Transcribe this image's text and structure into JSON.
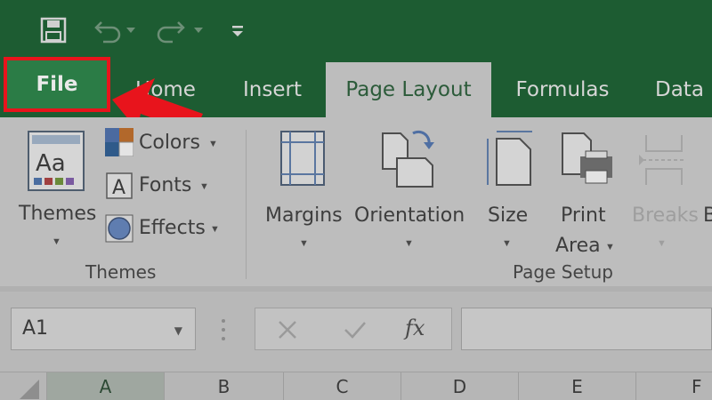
{
  "tabs": [
    {
      "id": "file",
      "label": "File"
    },
    {
      "id": "home",
      "label": "Home"
    },
    {
      "id": "insert",
      "label": "Insert"
    },
    {
      "id": "page_layout",
      "label": "Page Layout"
    },
    {
      "id": "formulas",
      "label": "Formulas"
    },
    {
      "id": "data",
      "label": "Data"
    }
  ],
  "ribbon": {
    "themes_group": {
      "themes_button": "Themes",
      "colors": "Colors",
      "fonts": "Fonts",
      "effects": "Effects",
      "group_label": "Themes"
    },
    "page_setup_group": {
      "margins": "Margins",
      "orientation": "Orientation",
      "size": "Size",
      "print_area_line1": "Print",
      "print_area_line2": "Area",
      "breaks": "Breaks",
      "cut_off_letter": "B",
      "group_label": "Page Setup"
    }
  },
  "formula_bar": {
    "name_box": "A1",
    "fx_label": "fx"
  },
  "columns": [
    "A",
    "B",
    "C",
    "D",
    "E",
    "F"
  ],
  "colors": {
    "title_bar": "#1d5c32",
    "file_tab": "#2b7c46",
    "highlight_box": "#e8141c",
    "ribbon": "#bdbdbd"
  }
}
